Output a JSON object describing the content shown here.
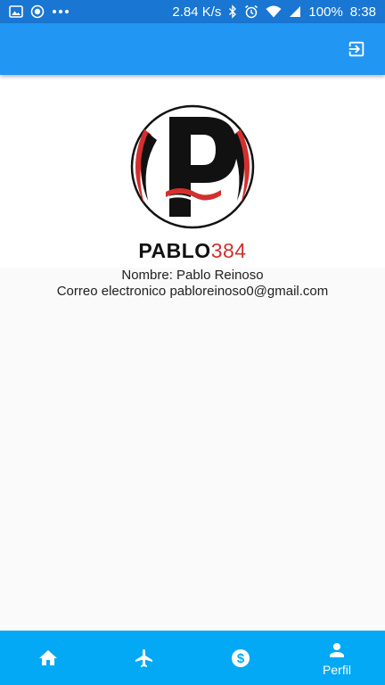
{
  "status_bar": {
    "speed": "2.84 K/s",
    "battery": "100%",
    "time": "8:38",
    "icons": [
      "image-icon",
      "circle-notification-icon",
      "more-dots-icon",
      "bluetooth-icon",
      "alarm-icon",
      "wifi-icon",
      "signal-icon",
      "battery-icon"
    ]
  },
  "app_bar": {
    "action_icon": "logout-icon"
  },
  "logo": {
    "name_dark": "PABLO",
    "name_red": "384",
    "letter": "P"
  },
  "profile": {
    "name_line": "Nombre: Pablo Reinoso",
    "email_line": "Correo electronico pabloreinoso0@gmail.com"
  },
  "bottom_nav": {
    "items": [
      {
        "icon": "home-icon",
        "label": ""
      },
      {
        "icon": "airplane-icon",
        "label": ""
      },
      {
        "icon": "dollar-icon",
        "label": ""
      },
      {
        "icon": "person-icon",
        "label": "Perfil"
      }
    ],
    "active_index": 3
  },
  "colors": {
    "status_bar": "#1976d2",
    "app_bar": "#2196f3",
    "bottom_nav": "#03a9f4",
    "logo_red": "#d32f2f"
  }
}
